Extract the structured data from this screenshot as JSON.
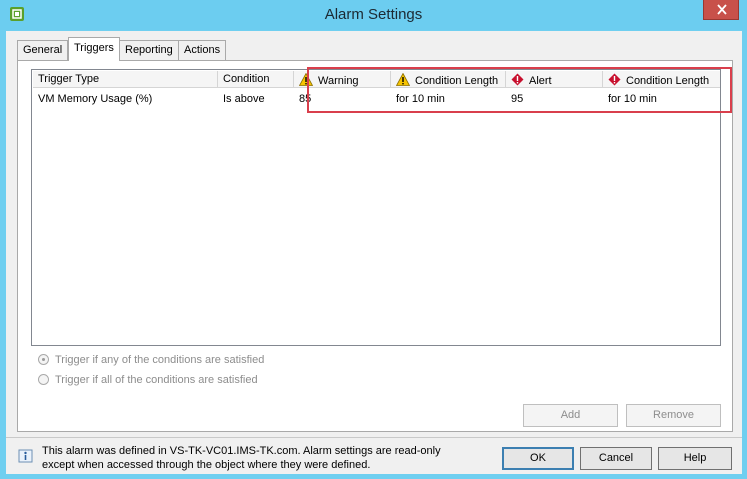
{
  "window": {
    "title": "Alarm Settings",
    "icon": "vsphere-app-icon"
  },
  "tabs": [
    {
      "label": "General",
      "active": false
    },
    {
      "label": "Triggers",
      "active": true
    },
    {
      "label": "Reporting",
      "active": false
    },
    {
      "label": "Actions",
      "active": false
    }
  ],
  "triggers": {
    "columns": [
      "Trigger Type",
      "Condition",
      "Warning",
      "Condition Length",
      "Alert",
      "Condition Length"
    ],
    "rows": [
      {
        "trigger_type": "VM Memory Usage (%)",
        "condition": "Is above",
        "warning": "85",
        "warning_length": "for 10 min",
        "alert": "95",
        "alert_length": "for 10 min"
      }
    ]
  },
  "options": {
    "any": "Trigger if any of the conditions are satisfied",
    "all": "Trigger if all of the conditions are satisfied",
    "selected": "any"
  },
  "buttons": {
    "add": "Add",
    "remove": "Remove",
    "ok": "OK",
    "cancel": "Cancel",
    "help": "Help"
  },
  "info": {
    "line1": "This alarm was defined in VS-TK-VC01.IMS-TK.com. Alarm settings are read-only",
    "line2": "except when accessed through the object where they were defined."
  },
  "colors": {
    "titlebar": "#6ccdf0",
    "highlight": "#d93f4c",
    "warning": "#f6c400",
    "alert": "#c8102e"
  }
}
